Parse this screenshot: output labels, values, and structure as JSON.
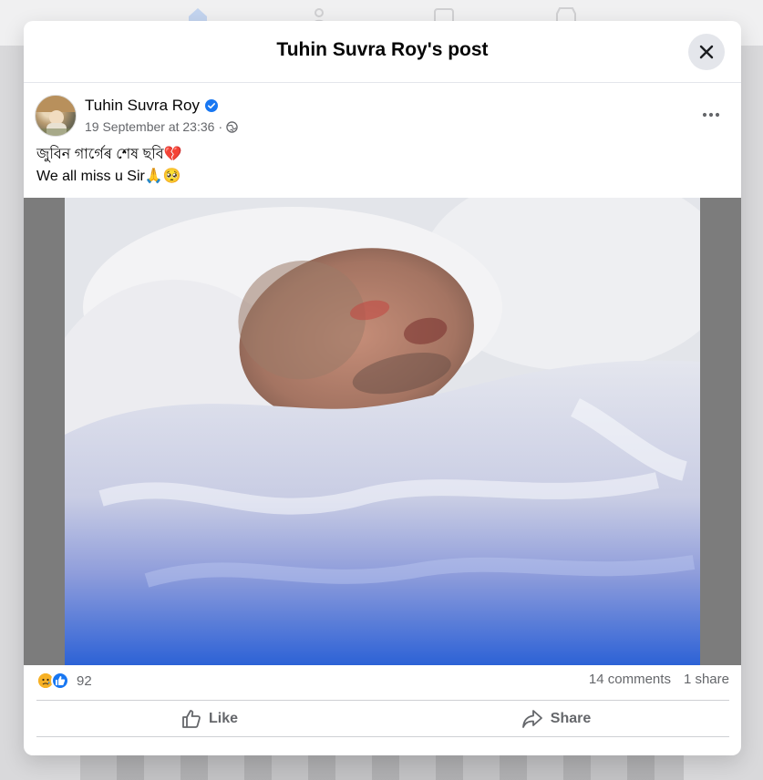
{
  "modal": {
    "title": "Tuhin Suvra Roy's post"
  },
  "post": {
    "author": "Tuhin Suvra Roy",
    "verified": true,
    "timestamp": "19 September at 23:36",
    "separator": "·",
    "audience_icon": "globe-icon",
    "text_line1": "জুবিন গাৰ্গেৰ শেষ ছবি💔",
    "text_line2": "We all miss u Sir🙏🥺"
  },
  "stats": {
    "reaction_icons": [
      "sad-reaction-icon",
      "like-reaction-icon"
    ],
    "reaction_count": "92",
    "comments": "14 comments",
    "shares": "1 share"
  },
  "actions": {
    "like_label": "Like",
    "share_label": "Share"
  },
  "colors": {
    "accent": "#1877f2",
    "secondary_text": "#65676b"
  }
}
